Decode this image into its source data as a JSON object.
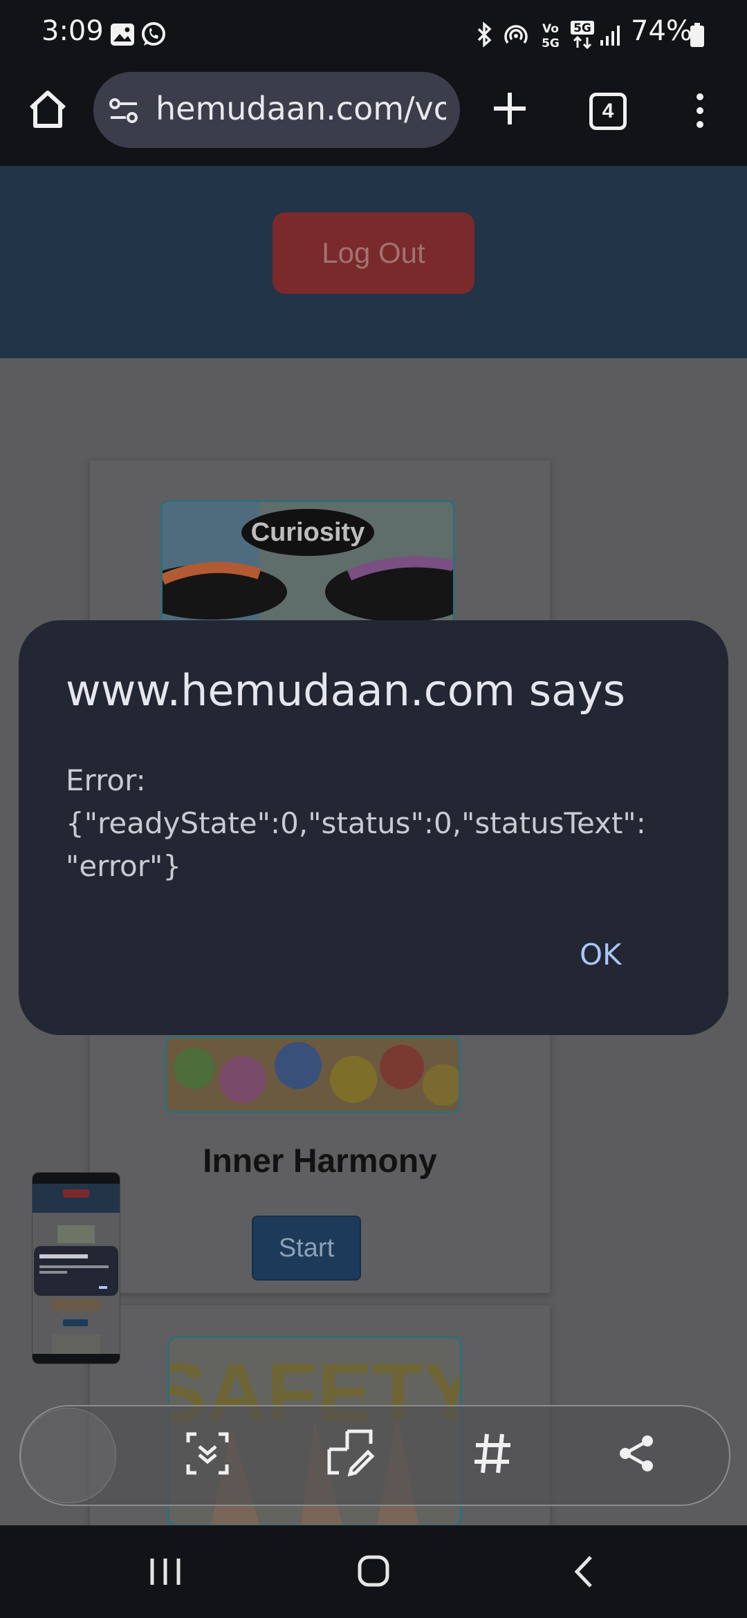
{
  "status_bar": {
    "time": "3:09",
    "battery": "74%"
  },
  "browser": {
    "url": "hemudaan.com/vo",
    "tab_count": "4"
  },
  "page": {
    "logout_label": "Log Out",
    "card_title": "Inner Harmony",
    "start_label": "Start",
    "curiosity_image_text": "Curiosity",
    "safety_image_text": "SAFETY"
  },
  "dialog": {
    "title": "www.hemudaan.com says",
    "message": "Error: {\"readyState\":0,\"status\":0,\"statusText\": \"error\"}",
    "ok_label": "OK"
  },
  "icons": [
    "home-icon",
    "site-settings-icon",
    "new-tab-icon",
    "tabs-icon",
    "more-vert-icon",
    "scroll-capture-icon",
    "draw-icon",
    "hashtag-icon",
    "share-icon",
    "recents-icon",
    "home-nav-icon",
    "back-icon"
  ]
}
